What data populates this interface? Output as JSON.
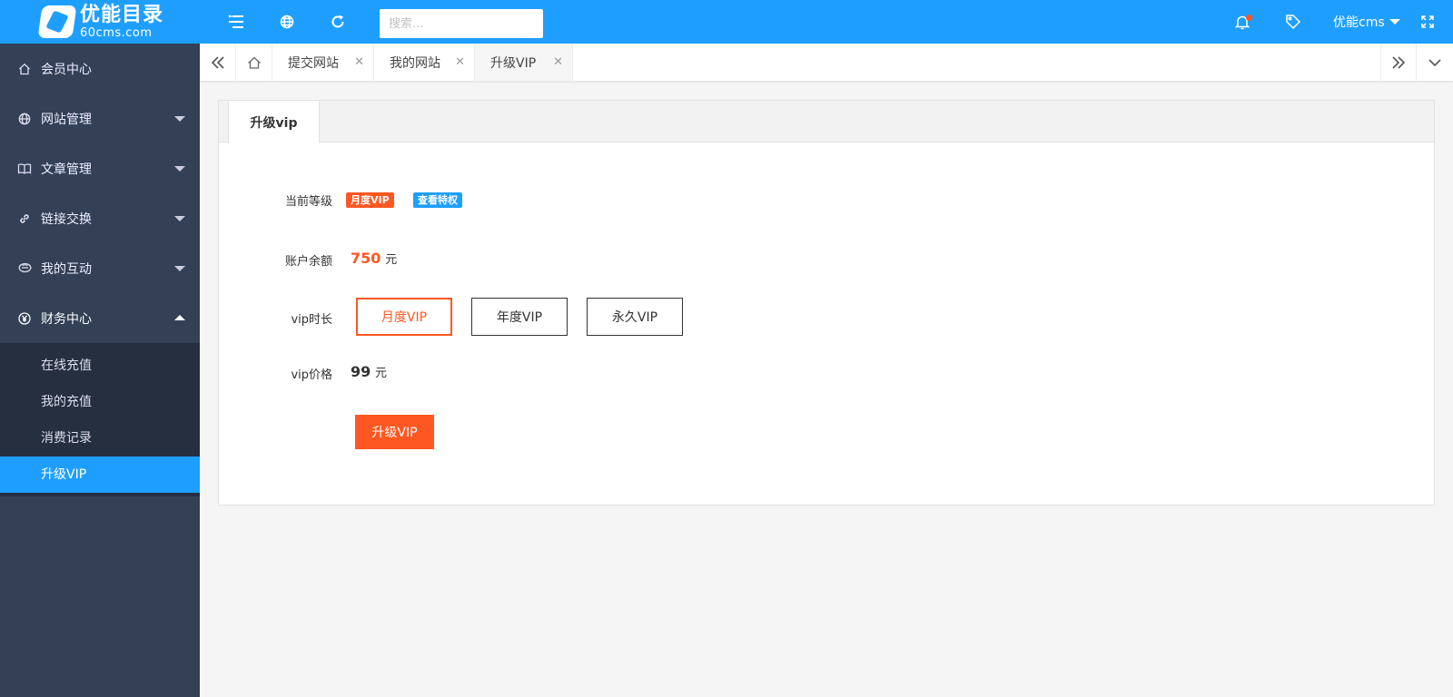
{
  "brand": {
    "name_cn": "优能目录",
    "name_en": "60cms.com"
  },
  "header": {
    "search_placeholder": "搜索...",
    "username": "优能cms",
    "icons": [
      "menu-icon",
      "globe-icon",
      "refresh-icon",
      "bell-icon",
      "tag-icon",
      "fullscreen-icon"
    ]
  },
  "sidebar": {
    "items": [
      {
        "label": "会员中心",
        "icon": "home-icon"
      },
      {
        "label": "网站管理",
        "icon": "globe-icon"
      },
      {
        "label": "文章管理",
        "icon": "book-icon"
      },
      {
        "label": "链接交换",
        "icon": "link-icon"
      },
      {
        "label": "我的互动",
        "icon": "chat-icon"
      },
      {
        "label": "财务中心",
        "icon": "yen-icon"
      }
    ],
    "finance_sub": [
      {
        "label": "在线充值"
      },
      {
        "label": "我的充值"
      },
      {
        "label": "消费记录"
      },
      {
        "label": "升级VIP",
        "active": true
      }
    ]
  },
  "tabs": [
    {
      "label": "提交网站"
    },
    {
      "label": "我的网站"
    },
    {
      "label": "升级VIP",
      "active": true
    }
  ],
  "card": {
    "tab_label": "升级vip",
    "level_label": "当前等级",
    "level_value": "月度VIP",
    "view_privileges": "查看特权",
    "balance_label": "账户余额",
    "balance_value": "750",
    "currency": "元",
    "duration_label": "vip时长",
    "duration_options": [
      "月度VIP",
      "年度VIP",
      "永久VIP"
    ],
    "selected_option": "月度VIP",
    "price_label": "vip价格",
    "price_value": "99",
    "submit_label": "升级VIP"
  },
  "colors": {
    "primary": "#1e9fff",
    "accent": "#ff5722",
    "sidebar": "#334055",
    "sidebar_sub": "#252f3f"
  }
}
